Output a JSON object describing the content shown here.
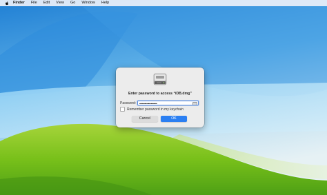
{
  "menubar": {
    "app_name": "Finder",
    "items": [
      "File",
      "Edit",
      "View",
      "Go",
      "Window",
      "Help"
    ]
  },
  "dialog": {
    "prompt": "Enter password to access “iDB.dmg”",
    "password_label": "Password:",
    "password_value": "••••••••••••••••••••",
    "remember_label": "Remember password in my keychain",
    "remember_checked": false,
    "cancel_label": "Cancel",
    "ok_label": "OK"
  },
  "icons": {
    "apple": "apple-logo-icon",
    "disk": "disk-image-icon",
    "keychain": "key-icon"
  },
  "colors": {
    "accent": "#2b7ff2",
    "sky_top": "#1f7fd4",
    "sky_light": "#d9ecf6",
    "hill_green": "#7fc21f"
  }
}
